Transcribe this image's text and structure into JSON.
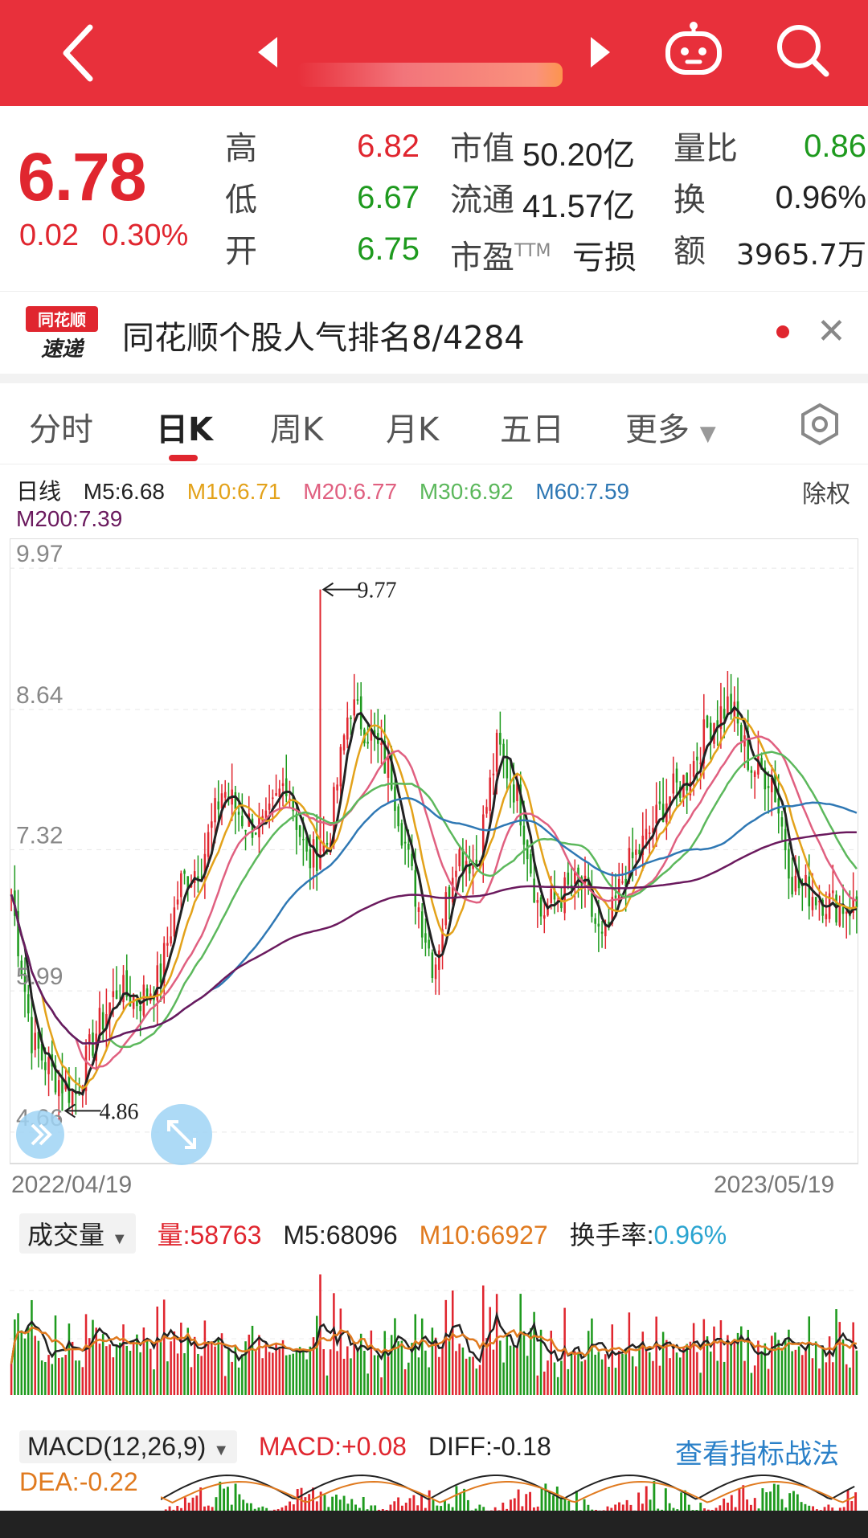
{
  "quote": {
    "price": "6.78",
    "change": "0.02",
    "change_pct": "0.30%",
    "high_label": "高",
    "high": "6.82",
    "low_label": "低",
    "low": "6.67",
    "open_label": "开",
    "open": "6.75",
    "mktcap_label": "市值",
    "mktcap": "50.20亿",
    "float_label": "流通",
    "float": "41.57亿",
    "pe_label": "市盈",
    "pe_tm": "TTM",
    "pe": "亏损",
    "vol_ratio_label": "量比",
    "vol_ratio": "0.86",
    "turnover_label": "换",
    "turnover": "0.96%",
    "amount_label": "额",
    "amount": "3965.7万"
  },
  "news": {
    "logo_top": "同花顺",
    "logo_bottom": "速递",
    "text": "同花顺个股人气排名8/4284"
  },
  "tabs": [
    {
      "label": "分时"
    },
    {
      "label": "日K"
    },
    {
      "label": "周K"
    },
    {
      "label": "月K"
    },
    {
      "label": "五日"
    },
    {
      "label": "更多"
    }
  ],
  "ma": {
    "period": "日线",
    "m5": "M5:6.68",
    "m10": "M10:6.71",
    "m20": "M20:6.77",
    "m30": "M30:6.92",
    "m60": "M60:7.59",
    "m200": "M200:7.39",
    "adjust": "除权",
    "colors": {
      "m5": "#222222",
      "m10": "#e3a21a",
      "m20": "#e06080",
      "m30": "#5cb85c",
      "m60": "#2f78b4",
      "m200": "#6b1a5e"
    }
  },
  "chart_data": {
    "type": "candlestick",
    "y_ticks": [
      "9.97",
      "8.64",
      "7.32",
      "5.99",
      "4.66"
    ],
    "max_label": "9.77",
    "min_label": "4.86",
    "x_start": "2022/04/19",
    "x_end": "2023/05/19",
    "close_path": [
      6.9,
      5.5,
      5.2,
      5.0,
      5.6,
      6.0,
      5.9,
      6.1,
      7.0,
      7.2,
      7.9,
      7.6,
      7.5,
      8.0,
      7.2,
      7.4,
      8.7,
      8.4,
      8.0,
      7.0,
      6.2,
      7.3,
      7.2,
      8.3,
      7.8,
      6.7,
      6.9,
      7.0,
      6.4,
      7.1,
      7.4,
      7.8,
      8.0,
      8.5,
      8.7,
      8.1,
      8.0,
      7.0,
      6.9,
      6.8,
      6.78
    ],
    "up_color": "#e0262f",
    "down_color": "#1e9a1e"
  },
  "volume": {
    "selector": "成交量",
    "vol": "量:58763",
    "m5": "M5:68096",
    "m10": "M10:66927",
    "turnover_label": "换手率:",
    "turnover": "0.96%"
  },
  "macd": {
    "selector": "MACD(12,26,9)",
    "macd": "MACD:+0.08",
    "diff": "DIFF:-0.18",
    "dea": "DEA:-0.22",
    "link": "查看指标战法"
  }
}
